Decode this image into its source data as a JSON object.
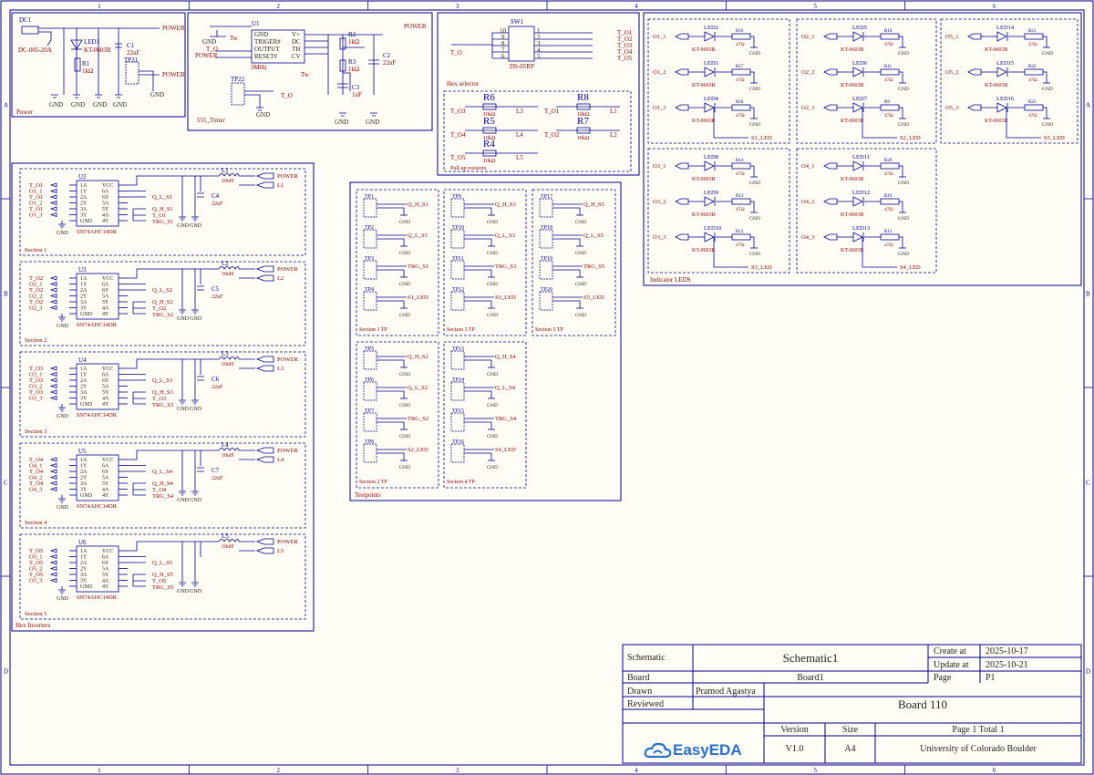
{
  "colors": {
    "frame": "#00008b",
    "wire": "#00008b",
    "part": "#8b0000",
    "text": "#222222",
    "background": "#fffdf5",
    "logo": "#2a6fc9"
  },
  "frame": {
    "columns": [
      "1",
      "2",
      "3",
      "4",
      "5",
      "6"
    ],
    "rows": [
      "A",
      "B",
      "C",
      "D"
    ]
  },
  "blocks": {
    "power": {
      "title": "Power",
      "connector": "DC1",
      "connector_part": "DC-005-20A",
      "led": "LED1",
      "led_part": "KT-0603R",
      "resistor": "R1",
      "resistor_value": "1kΩ",
      "cap": "C1",
      "cap_value": "22uF",
      "tp": "TP21",
      "net_power": "POWER",
      "gnd": "GND"
    },
    "timer": {
      "title": "555_Timer",
      "ic": "U1",
      "ic_part": "3MHz",
      "pins_left": [
        "GND",
        "TRIGER#",
        "OUTPUT",
        "RESET#"
      ],
      "pins_right": [
        "V+",
        "DC",
        "TH",
        "CV"
      ],
      "r2": "R2",
      "r2v": "1kΩ",
      "r3": "R3",
      "r3v": "1kΩ",
      "c2": "C2",
      "c2v": "22uF",
      "c3": "C3",
      "c3v": "1uF",
      "tp": "TP22",
      "net_out": "T_O",
      "net_power": "POWER",
      "gnd": "GND",
      "tw": "Tw"
    },
    "hex_selector": {
      "title": "Hex selector",
      "sw": "SW1",
      "sw_part": "DS-05RP",
      "left_pins": [
        "10",
        "9",
        "8",
        "7",
        "6"
      ],
      "right_pins": [
        "1",
        "2",
        "3",
        "4",
        "5"
      ],
      "outputs": [
        "T_O1",
        "T_O2",
        "T_O3",
        "T_O4",
        "T_O5"
      ],
      "input": "T_O"
    },
    "pullups": {
      "title": "Pull-up resistors",
      "items": [
        {
          "name": "R6",
          "value": "10kΩ",
          "left": "T_O3",
          "right": "L3"
        },
        {
          "name": "R8",
          "value": "10kΩ",
          "left": "T_O1",
          "right": "L1"
        },
        {
          "name": "R5",
          "value": "10kΩ",
          "left": "T_O4",
          "right": "L4"
        },
        {
          "name": "R7",
          "value": "10kΩ",
          "left": "T_O2",
          "right": "L2"
        },
        {
          "name": "R4",
          "value": "10kΩ",
          "left": "T_O5",
          "right": "L5"
        }
      ]
    },
    "inverters": {
      "title": "Hex Inverters",
      "pins_left": [
        "1A",
        "1Y",
        "2A",
        "2Y",
        "3A",
        "3Y",
        "GND"
      ],
      "pins_right": [
        "VCC",
        "6A",
        "6Y",
        "5A",
        "5Y",
        "4A",
        "4Y"
      ],
      "sections": [
        {
          "title": "Section 1",
          "ic": "U2",
          "part": "SN74AHC14DR",
          "inputs": [
            "T_O1",
            "O1_1",
            "T_O1",
            "O1_2",
            "T_O1",
            "O1_3"
          ],
          "outs": [
            "Q_L_S1",
            "Q_H_S1",
            "T_O1",
            "TRG_S1"
          ],
          "ind": "L1",
          "ind_val": "10uH",
          "cap": "C4",
          "cap_val": "22uF",
          "net_l": "L1"
        },
        {
          "title": "Section 2",
          "ic": "U3",
          "part": "SN74AHC14DR",
          "inputs": [
            "T_O2",
            "O2_1",
            "T_O2",
            "O2_2",
            "T_O2",
            "O2_3"
          ],
          "outs": [
            "Q_L_S2",
            "Q_H_S2",
            "T_O2",
            "TRG_S2"
          ],
          "ind": "L2",
          "ind_val": "10uH",
          "cap": "C5",
          "cap_val": "22uF",
          "net_l": "L2"
        },
        {
          "title": "Section 3",
          "ic": "U4",
          "part": "SN74AHC14DR",
          "inputs": [
            "T_O3",
            "O3_1",
            "T_O3",
            "O3_2",
            "T_O3",
            "O3_3"
          ],
          "outs": [
            "Q_L_S3",
            "Q_H_S3",
            "T_O3",
            "TRG_S3"
          ],
          "ind": "L3",
          "ind_val": "10uH",
          "cap": "C6",
          "cap_val": "22uF",
          "net_l": "L3"
        },
        {
          "title": "Section 4",
          "ic": "U5",
          "part": "SN74AHC14DR",
          "inputs": [
            "T_O4",
            "O4_1",
            "T_O4",
            "O4_2",
            "T_O4",
            "O4_3"
          ],
          "outs": [
            "Q_L_S4",
            "Q_H_S4",
            "T_O4",
            "TRG_S4"
          ],
          "ind": "L4",
          "ind_val": "10uH",
          "cap": "C7",
          "cap_val": "22uF",
          "net_l": "L4"
        },
        {
          "title": "Section 5",
          "ic": "U6",
          "part": "SN74AHC14DR",
          "inputs": [
            "T_O5",
            "O5_1",
            "T_O5",
            "O5_2",
            "T_O5",
            "O5_3"
          ],
          "outs": [
            "Q_L_S5",
            "Q_H_S5",
            "T_O5",
            "TRG_S5"
          ],
          "ind": "L5",
          "ind_val": "10uH",
          "cap": "",
          "cap_val": "",
          "net_l": "L5"
        }
      ]
    },
    "testpoints": {
      "title": "Testpoints",
      "sections": [
        {
          "title": "Section 1 TP",
          "tps": [
            "TP1",
            "TP2",
            "TP3",
            "TP4"
          ],
          "nets": [
            "Q_H_S1",
            "Q_L_S1",
            "TRG_S1",
            "S1_LED"
          ]
        },
        {
          "title": "Section 3 TP",
          "tps": [
            "TP9",
            "TP10",
            "TP11",
            "TP12"
          ],
          "nets": [
            "Q_H_S3",
            "Q_L_S3",
            "TRG_S3",
            "S3_LED"
          ]
        },
        {
          "title": "Section 5 TP",
          "tps": [
            "TP17",
            "TP18",
            "TP19",
            "TP20"
          ],
          "nets": [
            "Q_H_S5",
            "Q_L_S5",
            "TRG_S5",
            "S5_LED"
          ]
        },
        {
          "title": "Section 2 TP",
          "tps": [
            "TP5",
            "TP6",
            "TP7",
            "TP8"
          ],
          "nets": [
            "Q_H_S2",
            "Q_L_S2",
            "TRG_S2",
            "S2_LED"
          ]
        },
        {
          "title": "Section 4 TP",
          "tps": [
            "TP13",
            "TP14",
            "TP15",
            "TP16"
          ],
          "nets": [
            "Q_H_S4",
            "Q_L_S4",
            "TRG_S4",
            "S4_LED"
          ]
        }
      ]
    },
    "leds": {
      "title": "Indicator LEDS",
      "part": "KT-0603R",
      "value": "47Ω",
      "groups": [
        {
          "nets": [
            "O1_1",
            "O1_2",
            "O1_3"
          ],
          "leds": [
            "LED2",
            "LED3",
            "LED4"
          ],
          "res": [
            "R16",
            "R17",
            "R18"
          ],
          "out": "S1_LED"
        },
        {
          "nets": [
            "O2_1",
            "O2_2",
            "O2_3"
          ],
          "leds": [
            "LED5",
            "LED6",
            "LED7"
          ],
          "res": [
            "R10",
            "R11",
            "R9"
          ],
          "out": "S2_LED"
        },
        {
          "nets": [
            "O5_1",
            "O5_2",
            "O5_3"
          ],
          "leds": [
            "LED14",
            "LED15",
            "LED16"
          ],
          "res": [
            "R21",
            "R22",
            "R23"
          ],
          "out": "S5_LED"
        },
        {
          "nets": [
            "O3_1",
            "O3_2",
            "O3_3"
          ],
          "leds": [
            "LED8",
            "LED9",
            "LED10"
          ],
          "res": [
            "R14",
            "R13",
            "R12"
          ],
          "out": "S3_LED"
        },
        {
          "nets": [
            "O4_1",
            "O4_2",
            "O4_3"
          ],
          "leds": [
            "LED11",
            "LED12",
            "LED13"
          ],
          "res": [
            "R20",
            "R19",
            "R15"
          ],
          "out": "S4_LED"
        }
      ]
    }
  },
  "title_block": {
    "schematic_label": "Schematic",
    "schematic_name": "Schematic1",
    "create_label": "Create at",
    "create_date": "2025-10-17",
    "update_label": "Update at",
    "update_date": "2025-10-21",
    "board_label": "Board",
    "board_name": "Board1",
    "page_label": "Page",
    "page_value": "P1",
    "drawn_label": "Drawn",
    "drawn_value": "Pramod Agastya",
    "reviewed_label": "Reviewed",
    "reviewed_value": "",
    "title": "Board 110",
    "version_label": "Version",
    "version_value": "V1.0",
    "size_label": "Size",
    "size_value": "A4",
    "page_total": "Page  1  Total  1",
    "org": "University of Colorado Boulder",
    "logo_icon": "cloud-icon",
    "logo_text": "EasyEDA"
  }
}
